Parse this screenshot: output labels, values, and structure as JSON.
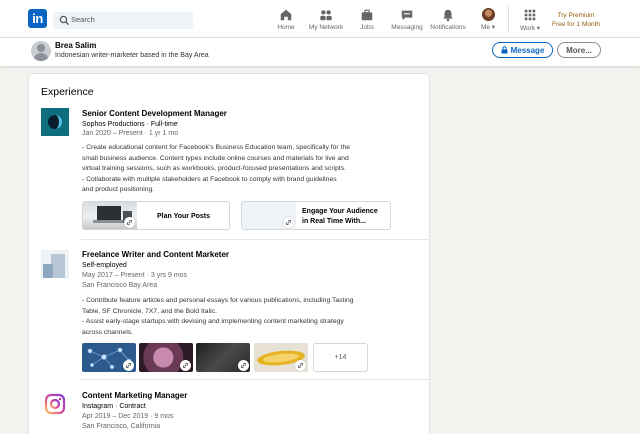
{
  "nav": {
    "search_placeholder": "Search",
    "items": [
      {
        "label": "Home",
        "icon": "home-icon"
      },
      {
        "label": "My Network",
        "icon": "network-icon"
      },
      {
        "label": "Jobs",
        "icon": "briefcase-icon"
      },
      {
        "label": "Messaging",
        "icon": "messaging-icon"
      },
      {
        "label": "Notifications",
        "icon": "bell-icon"
      },
      {
        "label": "Me ▾",
        "icon": "avatar"
      },
      {
        "label": "Work ▾",
        "icon": "grid-icon"
      }
    ],
    "premium_line1": "Try Premium",
    "premium_line2": "Free for 1 Month",
    "logo_text": "in"
  },
  "profile": {
    "name": "Brea Salim",
    "headline": "Indonesian writer-marketer based in the Bay Area",
    "message_label": "Message",
    "more_label": "More..."
  },
  "experience": {
    "heading": "Experience",
    "entries": [
      {
        "title": "Senior Content Development Manager",
        "company": "Sophos Productions · Full-time",
        "dates": "Jan 2020 – Present · 1 yr 1 mo",
        "description": [
          "- Create educational content for Facebook's Business Education team, specifically for the",
          "small business audience. Content types include online courses and materials for live and",
          "virtual training sessions, such as workbooks, product-focused presentations and scripts.",
          "- Collaborate with multiple stakeholders at Facebook to comply with brand guidelines",
          "and product positioning."
        ],
        "media": [
          {
            "title": "Plan Your Posts"
          },
          {
            "title_line1": "Engage Your Audience",
            "title_line2": "in Real Time With..."
          }
        ]
      },
      {
        "title": "Freelance Writer and Content Marketer",
        "company": "Self-employed",
        "dates": "May 2017 – Present · 3 yrs 9 mos",
        "location": "San Francisco Bay Area",
        "description": [
          "- Contribute feature articles and personal essays for various publications, including Tasting",
          "Table, SF Chronicle, 7X7, and the Bold Italic.",
          "- Assist early-stage startups with devising and implementing content marketing strategy",
          "across channels."
        ],
        "more_media": "+14"
      },
      {
        "title": "Content Marketing Manager",
        "company": "Instagram · Contract",
        "dates": "Apr 2019 – Dec 2019 · 9 mos",
        "location": "San Francisco, California"
      }
    ]
  },
  "colors": {
    "brand_blue": "#0a66c2",
    "premium_gold": "#915907",
    "background": "#f3f2ef"
  }
}
